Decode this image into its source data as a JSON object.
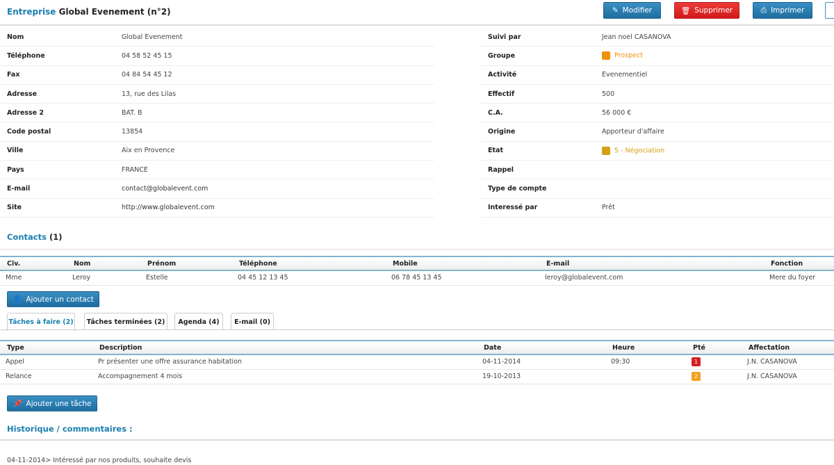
{
  "header": {
    "entity": "Entreprise",
    "title": "Global Evenement (n°2)",
    "buttons": {
      "edit": "Modifier",
      "delete": "Supprimer",
      "print": "Imprimer"
    }
  },
  "left_fields": [
    {
      "label": "Nom",
      "value": "Global Evenement"
    },
    {
      "label": "Téléphone",
      "value": "04 58 52 45 15"
    },
    {
      "label": "Fax",
      "value": "04 84 54 45 12"
    },
    {
      "label": "Adresse",
      "value": "13, rue des Lilas"
    },
    {
      "label": "Adresse 2",
      "value": "BAT. B"
    },
    {
      "label": "Code postal",
      "value": "13854"
    },
    {
      "label": "Ville",
      "value": "Aix en Provence"
    },
    {
      "label": "Pays",
      "value": "FRANCE"
    },
    {
      "label": "E-mail",
      "value": "contact@globalevent.com"
    },
    {
      "label": "Site",
      "value": "http://www.globalevent.com"
    }
  ],
  "right_fields": [
    {
      "label": "Suivi par",
      "value": "Jean noel CASANOVA"
    },
    {
      "label": "Groupe",
      "value": "Prospect",
      "color": "#f0900a"
    },
    {
      "label": "Activité",
      "value": "Evenementiel"
    },
    {
      "label": "Effectif",
      "value": "500"
    },
    {
      "label": "C.A.",
      "value": "56 000 €"
    },
    {
      "label": "Origine",
      "value": "Apporteur d'affaire"
    },
    {
      "label": "Etat",
      "value": "5 - Négociation",
      "color": "#d4a017"
    },
    {
      "label": "Rappel",
      "value": ""
    },
    {
      "label": "Type de compte",
      "value": ""
    },
    {
      "label": "Interessé par",
      "value": "Prêt"
    }
  ],
  "contacts": {
    "title": "Contacts",
    "count": "(1)",
    "columns": [
      "Civ.",
      "Nom",
      "Prénom",
      "Téléphone",
      "Mobile",
      "E-mail",
      "Fonction"
    ],
    "rows": [
      [
        "Mme",
        "Leroy",
        "Estelle",
        "04 45 12 13 45",
        "06 78 45 13 45",
        "leroy@globalevent.com",
        "Mere du foyer"
      ]
    ],
    "add_button": "Ajouter un contact"
  },
  "tabs": [
    "Tâches à faire (2)",
    "Tâches terminées (2)",
    "Agenda (4)",
    "E-mail (0)"
  ],
  "tasks": {
    "columns": [
      "Type",
      "Description",
      "Date",
      "Heure",
      "Pté",
      "Affectation"
    ],
    "rows": [
      [
        "Appel",
        "Pr présenter une offre assurance habitation",
        "04-11-2014",
        "09:30",
        "1",
        "J.N. CASANOVA"
      ],
      [
        "Relance",
        "Accompagnement 4 mois",
        "19-10-2013",
        "",
        "2",
        "J.N. CASANOVA"
      ]
    ],
    "priority_colors": {
      "1": "#d42020",
      "2": "#f5a020"
    },
    "add_button": "Ajouter une tâche"
  },
  "history": {
    "title": "Historique / commentaires :",
    "entries": [
      "04-11-2014> Intéressé par nos produits, souhaite devis"
    ]
  }
}
